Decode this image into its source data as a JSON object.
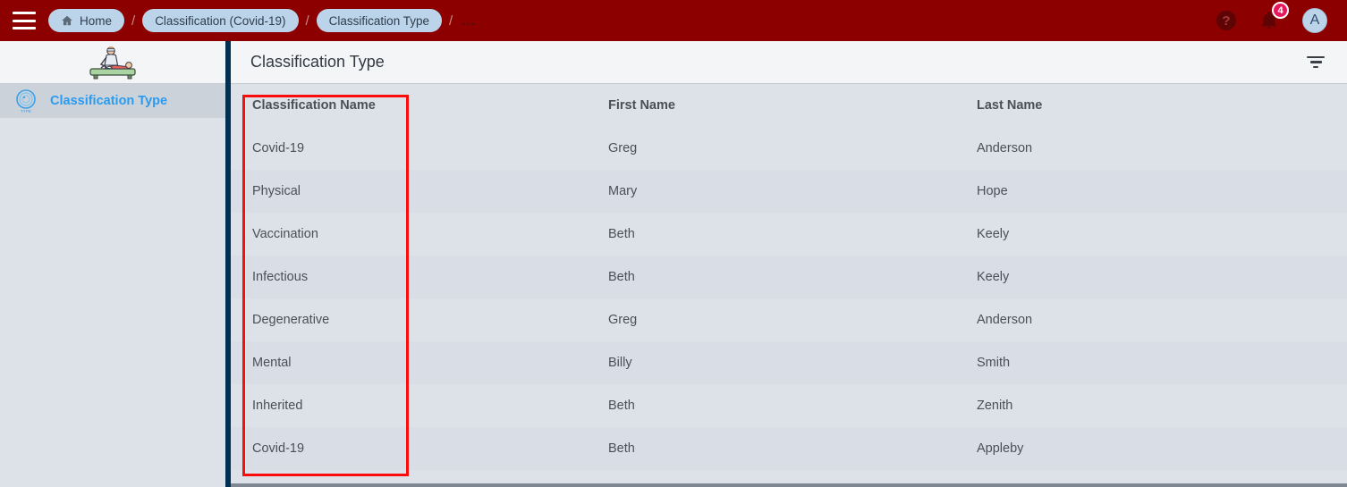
{
  "topbar": {
    "menu_icon": "hamburger-menu-icon",
    "breadcrumbs": [
      {
        "label": "Home",
        "icon": "home-icon"
      },
      {
        "label": "Classification (Covid-19)",
        "icon": ""
      },
      {
        "label": "Classification Type",
        "icon": ""
      }
    ],
    "separator": "/",
    "overflow": "...",
    "help_icon_glyph": "?",
    "help_icon_name": "help-icon",
    "bell_icon_name": "notifications-bell-icon",
    "notification_count": "4",
    "avatar_initial": "A",
    "bar_color": "#8c0000",
    "pill_color": "#bcd4ea",
    "badge_color": "#e8175d"
  },
  "sidebar": {
    "logo_icon": "physiotherapy-illustration-logo",
    "items": [
      {
        "label": "Classification Type",
        "icon": "classification-type-icon",
        "selected": true
      }
    ],
    "selected_text_color": "#2a9bf0"
  },
  "panel": {
    "title": "Classification Type",
    "filter_icon": "filter-icon"
  },
  "table": {
    "columns": [
      "Classification Name",
      "First Name",
      "Last Name"
    ],
    "rows": [
      {
        "classification": "Covid-19",
        "first": "Greg",
        "last": "Anderson"
      },
      {
        "classification": "Physical",
        "first": "Mary",
        "last": "Hope"
      },
      {
        "classification": "Vaccination",
        "first": "Beth",
        "last": "Keely"
      },
      {
        "classification": "Infectious",
        "first": "Beth",
        "last": "Keely"
      },
      {
        "classification": "Degenerative",
        "first": "Greg",
        "last": "Anderson"
      },
      {
        "classification": "Mental",
        "first": "Billy",
        "last": "Smith"
      },
      {
        "classification": "Inherited",
        "first": "Beth",
        "last": "Zenith"
      },
      {
        "classification": "Covid-19",
        "first": "Beth",
        "last": "Appleby"
      }
    ]
  },
  "annotation": {
    "color": "#fc0d0d",
    "target": "classification-name-column"
  }
}
